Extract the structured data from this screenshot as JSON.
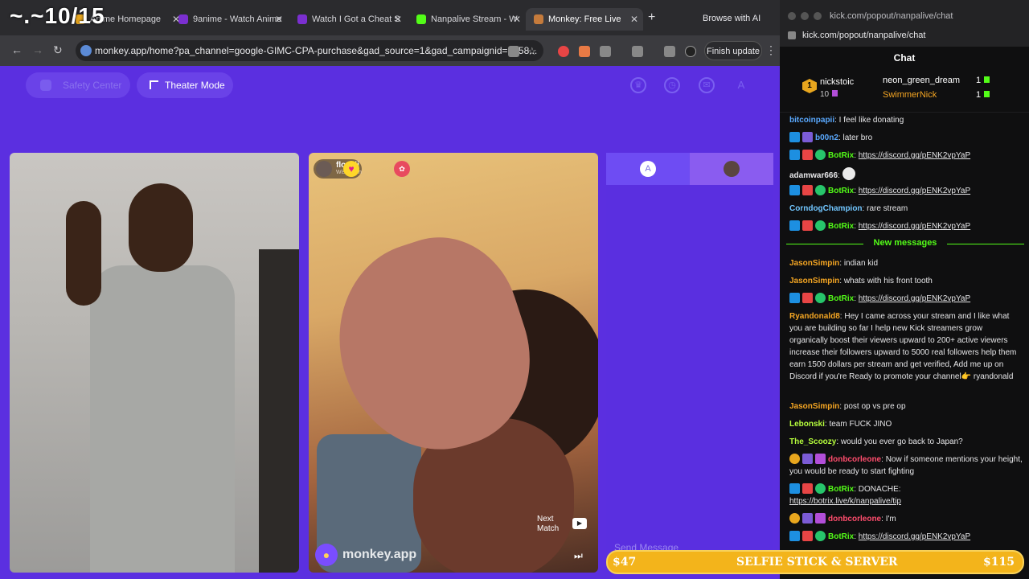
{
  "overlay_counter": "~.~10/15",
  "tabs": [
    {
      "label": "Anime Homepage",
      "favicon_color": "#e8a61e"
    },
    {
      "label": "9anime - Watch Anime",
      "favicon_color": "#7b2fd0"
    },
    {
      "label": "Watch I Got a Cheat S",
      "favicon_color": "#7b2fd0"
    },
    {
      "label": "Nanpalive Stream - W",
      "favicon_color": "#53fc18"
    },
    {
      "label": "Monkey: Free Live",
      "favicon_color": "#c57b3c"
    }
  ],
  "browse_ai": "Browse with AI",
  "address": {
    "url": "monkey.app/home?pa_channel=google-GIMC-CPA-purchase&gad_source=1&gad_campaignid=2258..."
  },
  "finish_update": "Finish update",
  "page": {
    "safety_center": "Safety Center",
    "theater_mode": "Theater Mode",
    "avatar_letter": "A",
    "remote_user": {
      "name": "floskii",
      "location": "Wisconsin"
    },
    "next_match": "Next Match",
    "brand": "monkey.app",
    "side_letter": "A",
    "send_message_placeholder": "Send Message"
  },
  "chat_window": {
    "url_title": "kick.com/popout/nanpalive/chat",
    "url": "kick.com/popout/nanpalive/chat",
    "title": "Chat",
    "leaderboard": {
      "top": {
        "rank": "1",
        "name": "nickstoic",
        "count": "10"
      },
      "second": {
        "name": "neon_green_dream",
        "count": "1"
      },
      "third": {
        "name": "SwimmerNick",
        "count": "1"
      }
    },
    "new_messages": "New messages",
    "messages": [
      {
        "user": "bitcoinpapii",
        "text": "I feel like donating"
      },
      {
        "user": "b00n2",
        "text": "later bro"
      },
      {
        "user": "BotRix",
        "link": "https://discord.gg/pENK2vpYaP"
      },
      {
        "user": "adamwar666",
        "text": ""
      },
      {
        "user": "BotRix",
        "link": "https://discord.gg/pENK2vpYaP"
      },
      {
        "user": "CorndogChampion",
        "text": "rare stream"
      },
      {
        "user": "BotRix",
        "link": "https://discord.gg/pENK2vpYaP"
      },
      {
        "user": "JasonSimpin",
        "text": "indian kid"
      },
      {
        "user": "JasonSimpin",
        "text": "whats with his front tooth"
      },
      {
        "user": "BotRix",
        "link": "https://discord.gg/pENK2vpYaP"
      },
      {
        "user": "Ryandonald8",
        "text": "Hey I came across your stream and I like what you are building so far I help new Kick streamers grow organically boost their viewers upward to 200+ active viewers increase their followers upward to 5000 real followers help them earn 1500 dollars per stream and get verified, Add me up on Discord if you're Ready to promote your channel👉 ryandonald"
      },
      {
        "user": "JasonSimpin",
        "text": "post op vs pre op"
      },
      {
        "user": "Lebonski",
        "text": "team FUCK JINO"
      },
      {
        "user": "The_Scoozy",
        "text": "would you ever go back to Japan?"
      },
      {
        "user": "donbcorleone",
        "text": "Now if someone mentions your height, you would be ready to start fighting"
      },
      {
        "user": "BotRix",
        "text": "DONACHE:",
        "link": "https://botrix.live/k/nanpalive/tip"
      },
      {
        "user": "donbcorleone",
        "text": "I'm"
      },
      {
        "user": "BotRix",
        "link": "https://discord.gg/pENK2vpYaP"
      }
    ]
  },
  "donation_bar": {
    "left": "$47",
    "center": "SELFIE STICK & SERVER",
    "right": "$115"
  }
}
